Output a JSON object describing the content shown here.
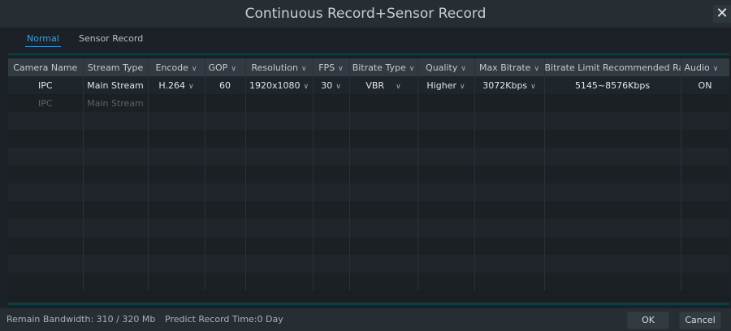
{
  "window": {
    "title": "Continuous Record+Sensor Record",
    "close_glyph": "✕"
  },
  "tabs": [
    {
      "label": "Normal",
      "active": true
    },
    {
      "label": "Sensor Record",
      "active": false
    }
  ],
  "table": {
    "columns": [
      {
        "label": "Camera Name",
        "dropdown": false
      },
      {
        "label": "Stream Type",
        "dropdown": false
      },
      {
        "label": "Encode",
        "dropdown": true
      },
      {
        "label": "GOP",
        "dropdown": true
      },
      {
        "label": "Resolution",
        "dropdown": true
      },
      {
        "label": "FPS",
        "dropdown": true
      },
      {
        "label": "Bitrate Type",
        "dropdown": true
      },
      {
        "label": "Quality",
        "dropdown": true
      },
      {
        "label": "Max Bitrate",
        "dropdown": true
      },
      {
        "label": "Bitrate Limit Recommended Ran...",
        "dropdown": false
      },
      {
        "label": "Audio",
        "dropdown": true
      }
    ],
    "rows": [
      {
        "camera": "IPC",
        "stream": "Main Stream",
        "encode": "H.264",
        "gop": "60",
        "resolution": "1920x1080",
        "fps": "30",
        "bitrate_type": "VBR",
        "quality": "Higher",
        "max_bitrate": "3072Kbps",
        "bitrate_limit": "5145~8576Kbps",
        "audio": "ON"
      },
      {
        "camera": "IPC",
        "stream": "Main Stream"
      }
    ],
    "dropdown_glyph": "∨"
  },
  "footer": {
    "remain_bandwidth": "Remain Bandwidth: 310 / 320 Mb",
    "predict_record_time": "Predict Record Time:0 Day",
    "ok_label": "OK",
    "cancel_label": "Cancel"
  },
  "colors": {
    "accent": "#3a9fe3",
    "rule": "#0e3f45",
    "background": "#1b2126"
  }
}
